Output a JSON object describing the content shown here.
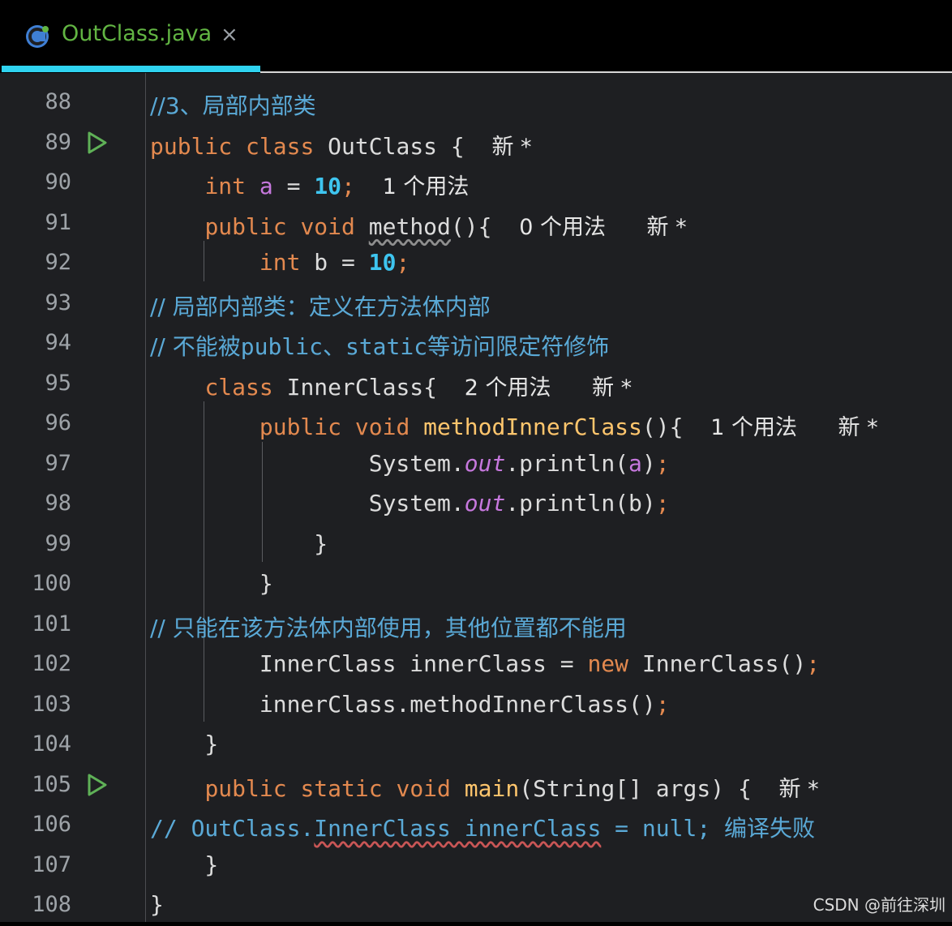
{
  "tab": {
    "title": "OutClass.java",
    "close": "×",
    "icon": "java-class-icon"
  },
  "hints": {
    "new": "新 *",
    "u1": "1 个用法",
    "u0": "0 个用法",
    "u2": "2 个用法"
  },
  "lines": [
    {
      "n": "88"
    },
    {
      "n": "89"
    },
    {
      "n": "90"
    },
    {
      "n": "91"
    },
    {
      "n": "92"
    },
    {
      "n": "93"
    },
    {
      "n": "94"
    },
    {
      "n": "95"
    },
    {
      "n": "96"
    },
    {
      "n": "97"
    },
    {
      "n": "98"
    },
    {
      "n": "99"
    },
    {
      "n": "100"
    },
    {
      "n": "101"
    },
    {
      "n": "102"
    },
    {
      "n": "103"
    },
    {
      "n": "104"
    },
    {
      "n": "105"
    },
    {
      "n": "106"
    },
    {
      "n": "107"
    },
    {
      "n": "108"
    }
  ],
  "code": {
    "c88": "//3、局部内部类",
    "c93": "// 局部内部类：定义在方法体内部",
    "c94a": "// 不能被",
    "c94b": "public",
    "c94c": "、",
    "c94d": "static",
    "c94e": "等访问限定符修饰",
    "c101": "// 只能在该方法体内部使用，其他位置都不能用",
    "c106a": "// OutClass.",
    "c106b": "InnerClass innerClass",
    "c106c": " = null; ",
    "c106d": "编译失败",
    "kw_public": "public",
    "kw_class": "class",
    "kw_int": "int",
    "kw_void": "void",
    "kw_static": "static",
    "kw_new": "new",
    "id_OutClass": "OutClass",
    "id_InnerClass": "InnerClass",
    "id_method": "method",
    "id_methodInnerClass": "methodInnerClass",
    "id_main": "main",
    "id_a": "a",
    "id_b": "b",
    "id_out": "out",
    "id_System": "System",
    "id_println": "println",
    "id_innerClass": "innerClass",
    "id_String": "String",
    "id_args": "args",
    "num_10": "10"
  },
  "watermark": "CSDN @前往深圳"
}
